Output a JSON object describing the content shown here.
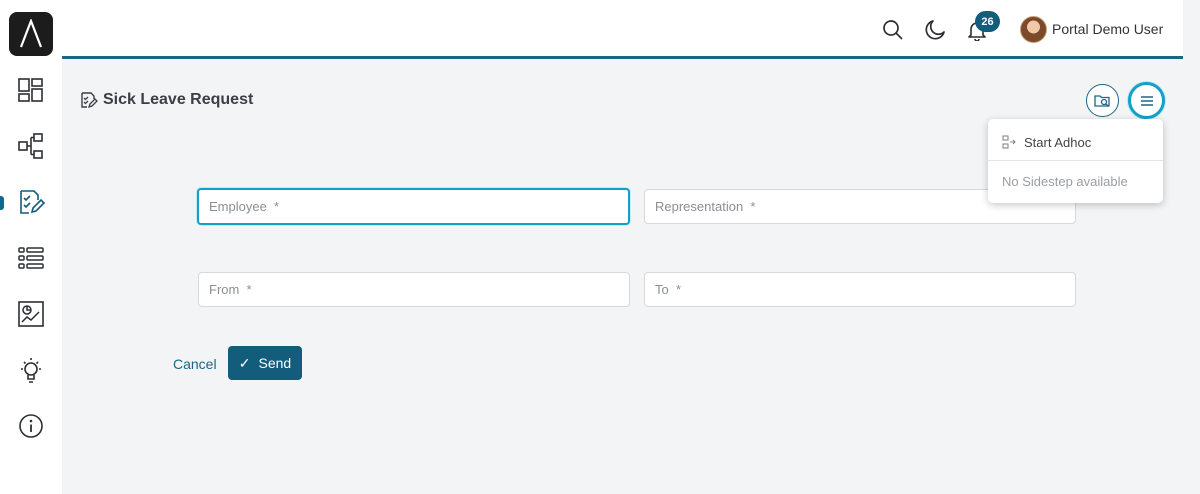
{
  "header": {
    "notification_count": "26",
    "user_name": "Portal Demo User"
  },
  "page": {
    "title": "Sick Leave Request"
  },
  "form": {
    "employee_placeholder": "Employee  *",
    "representation_placeholder": "Representation  *",
    "from_placeholder": "From  *",
    "to_placeholder": "To  *",
    "cancel_label": "Cancel",
    "send_label": "Send"
  },
  "dropdown": {
    "start_adhoc_label": "Start Adhoc",
    "no_sidestep_label": "No Sidestep available"
  },
  "sidebar": {
    "items": [
      {
        "icon": "dashboard-icon"
      },
      {
        "icon": "process-icon"
      },
      {
        "icon": "tasks-icon",
        "active": true
      },
      {
        "icon": "list-icon"
      },
      {
        "icon": "reports-icon"
      },
      {
        "icon": "ideas-icon"
      },
      {
        "icon": "info-icon"
      }
    ]
  },
  "colors": {
    "accent": "#125d7c",
    "focus": "#12a0c8",
    "header_border": "#1b6585"
  }
}
